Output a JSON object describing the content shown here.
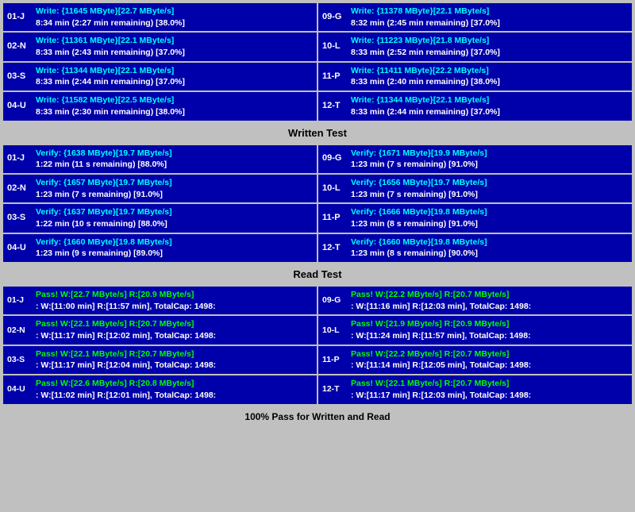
{
  "sections": {
    "write_test": {
      "label": "Written Test",
      "rows": [
        {
          "left": {
            "id": "01-J",
            "line1": "Write: {11645 MByte}[22.7 MByte/s]",
            "line2": "8:34 min (2:27 min remaining)  [38.0%]"
          },
          "right": {
            "id": "09-G",
            "line1": "Write: {11378 MByte}[22.1 MByte/s]",
            "line2": "8:32 min (2:45 min remaining)  [37.0%]"
          }
        },
        {
          "left": {
            "id": "02-N",
            "line1": "Write: {11361 MByte}[22.1 MByte/s]",
            "line2": "8:33 min (2:43 min remaining)  [37.0%]"
          },
          "right": {
            "id": "10-L",
            "line1": "Write: {11223 MByte}[21.8 MByte/s]",
            "line2": "8:33 min (2:52 min remaining)  [37.0%]"
          }
        },
        {
          "left": {
            "id": "03-S",
            "line1": "Write: {11344 MByte}[22.1 MByte/s]",
            "line2": "8:33 min (2:44 min remaining)  [37.0%]"
          },
          "right": {
            "id": "11-P",
            "line1": "Write: {11411 MByte}[22.2 MByte/s]",
            "line2": "8:33 min (2:40 min remaining)  [38.0%]"
          }
        },
        {
          "left": {
            "id": "04-U",
            "line1": "Write: {11582 MByte}[22.5 MByte/s]",
            "line2": "8:33 min (2:30 min remaining)  [38.0%]"
          },
          "right": {
            "id": "12-T",
            "line1": "Write: {11344 MByte}[22.1 MByte/s]",
            "line2": "8:33 min (2:44 min remaining)  [37.0%]"
          }
        }
      ]
    },
    "verify_test": {
      "label": "Written Test",
      "rows": [
        {
          "left": {
            "id": "01-J",
            "line1": "Verify: {1638 MByte}[19.7 MByte/s]",
            "line2": "1:22 min (11 s remaining)   [88.0%]"
          },
          "right": {
            "id": "09-G",
            "line1": "Verify: {1671 MByte}[19.9 MByte/s]",
            "line2": "1:23 min (7 s remaining)   [91.0%]"
          }
        },
        {
          "left": {
            "id": "02-N",
            "line1": "Verify: {1657 MByte}[19.7 MByte/s]",
            "line2": "1:23 min (7 s remaining)   [91.0%]"
          },
          "right": {
            "id": "10-L",
            "line1": "Verify: {1656 MByte}[19.7 MByte/s]",
            "line2": "1:23 min (7 s remaining)   [91.0%]"
          }
        },
        {
          "left": {
            "id": "03-S",
            "line1": "Verify: {1637 MByte}[19.7 MByte/s]",
            "line2": "1:22 min (10 s remaining)   [88.0%]"
          },
          "right": {
            "id": "11-P",
            "line1": "Verify: {1666 MByte}[19.8 MByte/s]",
            "line2": "1:23 min (8 s remaining)   [91.0%]"
          }
        },
        {
          "left": {
            "id": "04-U",
            "line1": "Verify: {1660 MByte}[19.8 MByte/s]",
            "line2": "1:23 min (9 s remaining)   [89.0%]"
          },
          "right": {
            "id": "12-T",
            "line1": "Verify: {1660 MByte}[19.8 MByte/s]",
            "line2": "1:23 min (8 s remaining)   [90.0%]"
          }
        }
      ]
    },
    "read_test": {
      "label": "Read Test",
      "rows": [
        {
          "left": {
            "id": "01-J",
            "line1": "Pass! W:[22.7 MByte/s] R:[20.9 MByte/s]",
            "line2": ": W:[11:00 min] R:[11:57 min], TotalCap: 1498:"
          },
          "right": {
            "id": "09-G",
            "line1": "Pass! W:[22.2 MByte/s] R:[20.7 MByte/s]",
            "line2": ": W:[11:16 min] R:[12:03 min], TotalCap: 1498:"
          }
        },
        {
          "left": {
            "id": "02-N",
            "line1": "Pass! W:[22.1 MByte/s] R:[20.7 MByte/s]",
            "line2": ": W:[11:17 min] R:[12:02 min], TotalCap: 1498:"
          },
          "right": {
            "id": "10-L",
            "line1": "Pass! W:[21.9 MByte/s] R:[20.9 MByte/s]",
            "line2": ": W:[11:24 min] R:[11:57 min], TotalCap: 1498:"
          }
        },
        {
          "left": {
            "id": "03-S",
            "line1": "Pass! W:[22.1 MByte/s] R:[20.7 MByte/s]",
            "line2": ": W:[11:17 min] R:[12:04 min], TotalCap: 1498:"
          },
          "right": {
            "id": "11-P",
            "line1": "Pass! W:[22.2 MByte/s] R:[20.7 MByte/s]",
            "line2": ": W:[11:14 min] R:[12:05 min], TotalCap: 1498:"
          }
        },
        {
          "left": {
            "id": "04-U",
            "line1": "Pass! W:[22.6 MByte/s] R:[20.8 MByte/s]",
            "line2": ": W:[11:02 min] R:[12:01 min], TotalCap: 1498:"
          },
          "right": {
            "id": "12-T",
            "line1": "Pass! W:[22.1 MByte/s] R:[20.7 MByte/s]",
            "line2": ": W:[11:17 min] R:[12:03 min], TotalCap: 1498:"
          }
        }
      ]
    }
  },
  "headers": {
    "write_section": "Written Test",
    "read_section": "Read Test",
    "footer": "100% Pass for Written and Read"
  }
}
